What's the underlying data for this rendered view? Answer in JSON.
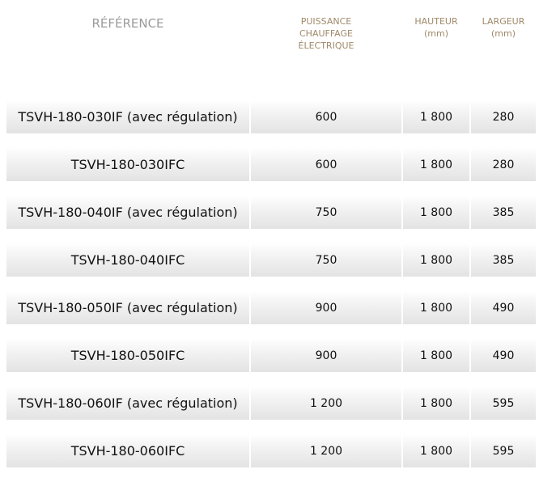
{
  "headers": {
    "reference": "RÉFÉRENCE",
    "power": [
      "PUISSANCE",
      "CHAUFFAGE",
      "ÉLECTRIQUE"
    ],
    "height": [
      "HAUTEUR",
      "(mm)"
    ],
    "width": [
      "LARGEUR",
      "(mm)"
    ]
  },
  "rows": [
    {
      "reference": "TSVH-180-030IF (avec régulation)",
      "power": "600",
      "height": "1 800",
      "width": "280"
    },
    {
      "reference": "TSVH-180-030IFC",
      "power": "600",
      "height": "1 800",
      "width": "280"
    },
    {
      "reference": "TSVH-180-040IF (avec régulation)",
      "power": "750",
      "height": "1 800",
      "width": "385"
    },
    {
      "reference": "TSVH-180-040IFC",
      "power": "750",
      "height": "1 800",
      "width": "385"
    },
    {
      "reference": "TSVH-180-050IF (avec régulation)",
      "power": "900",
      "height": "1 800",
      "width": "490"
    },
    {
      "reference": "TSVH-180-050IFC",
      "power": "900",
      "height": "1 800",
      "width": "490"
    },
    {
      "reference": "TSVH-180-060IF (avec régulation)",
      "power": "1 200",
      "height": "1 800",
      "width": "595"
    },
    {
      "reference": "TSVH-180-060IFC",
      "power": "1 200",
      "height": "1 800",
      "width": "595"
    }
  ]
}
